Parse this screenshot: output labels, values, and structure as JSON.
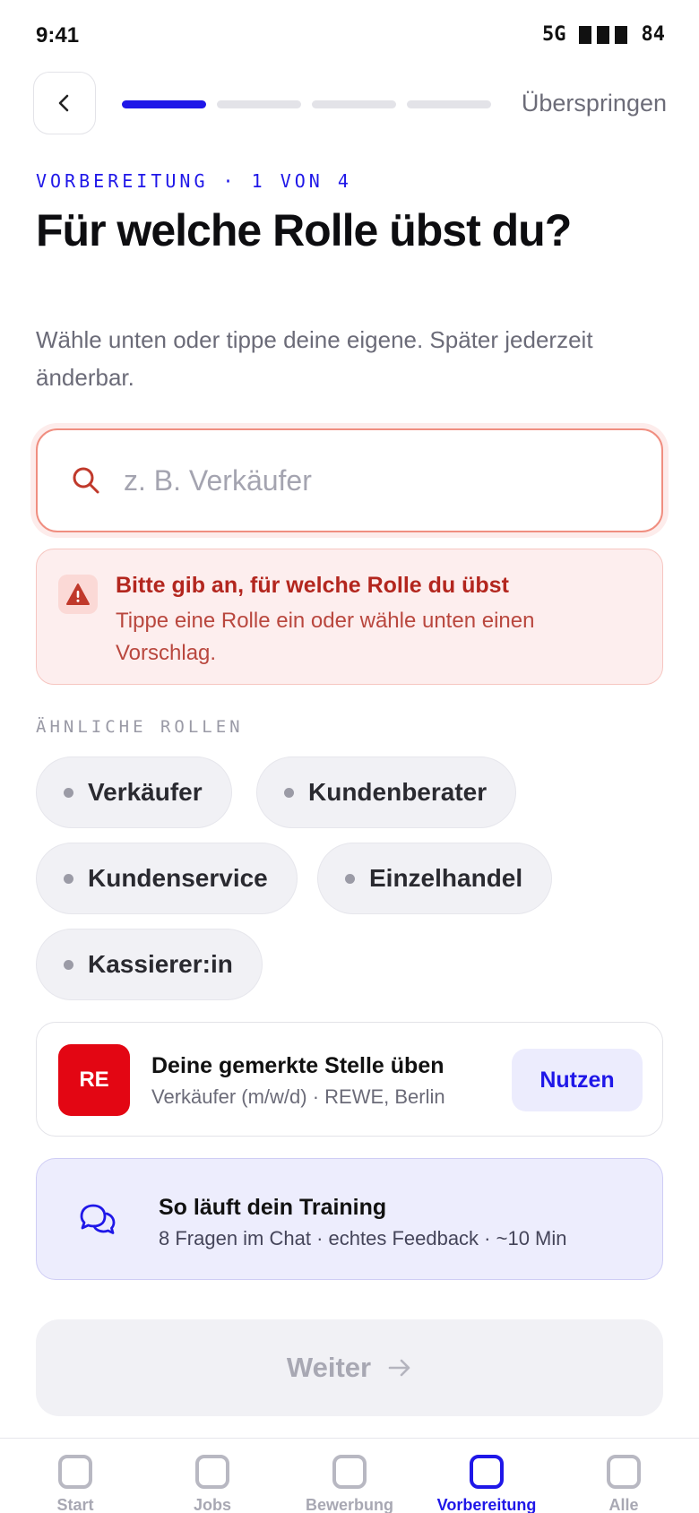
{
  "status_bar": {
    "time": "9:41",
    "network": "5G",
    "battery": "84"
  },
  "nav": {
    "back_icon": "chevron-left-icon",
    "skip_label": "Überspringen",
    "progress": {
      "current": 1,
      "total": 4
    }
  },
  "header": {
    "eyebrow": "VORBEREITUNG · 1 VON 4",
    "title": "Für welche Rolle übst du?",
    "subtitle": "Wähle unten oder tippe deine eigene. Später jederzeit änderbar."
  },
  "search": {
    "placeholder": "z. B. Verkäufer",
    "value": "",
    "icon": "search-icon"
  },
  "error": {
    "icon": "warning-icon",
    "title": "Bitte gib an, für welche Rolle du übst",
    "text": "Tippe eine Rolle ein oder wähle unten einen Vorschlag."
  },
  "similar_roles": {
    "label": "ÄHNLICHE ROLLEN",
    "items": [
      "Verkäufer",
      "Kundenberater",
      "Kundenservice",
      "Einzelhandel",
      "Kassierer:in"
    ]
  },
  "saved_job": {
    "logo_text": "RE",
    "title": "Deine gemerkte Stelle üben",
    "subtitle": "Verkäufer (m/w/d) · REWE, Berlin",
    "button_label": "Nutzen",
    "logo_color": "#e30613"
  },
  "training": {
    "icon": "chat-bubbles-icon",
    "title": "So läuft dein Training",
    "subtitle": "8 Fragen im Chat · echtes Feedback · ~10 Min"
  },
  "next_button": {
    "label": "Weiter",
    "icon": "arrow-right-icon",
    "disabled": true
  },
  "tab_bar": {
    "tabs": [
      {
        "label": "Start"
      },
      {
        "label": "Jobs"
      },
      {
        "label": "Bewerbung"
      },
      {
        "label": "Vorbereitung",
        "active": true
      },
      {
        "label": "Alle"
      }
    ]
  },
  "colors": {
    "accent": "#1f17e8",
    "error": "#b3261e",
    "error_bg": "#fdeeee"
  }
}
